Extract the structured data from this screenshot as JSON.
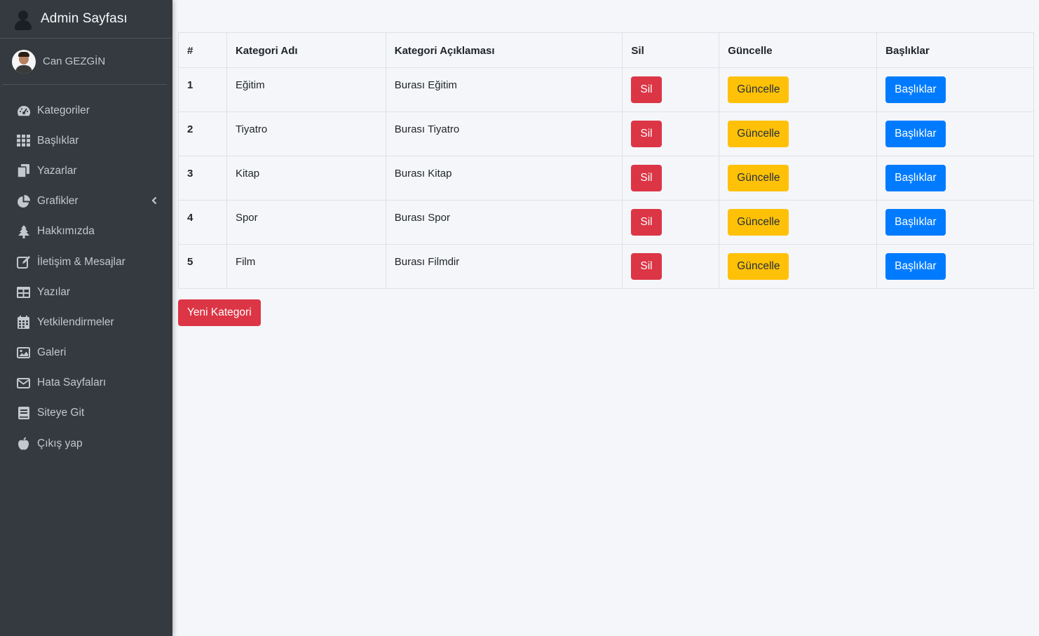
{
  "app": {
    "title": "Admin Sayfası",
    "brand_icon": "user-icon"
  },
  "user": {
    "name": "Can GEZGİN",
    "avatar_icon": "avatar"
  },
  "sidebar": {
    "items": [
      {
        "label": "Kategoriler",
        "icon": "tachometer-icon"
      },
      {
        "label": "Başlıklar",
        "icon": "grid-icon"
      },
      {
        "label": "Yazarlar",
        "icon": "copy-icon"
      },
      {
        "label": "Grafikler",
        "icon": "pie-chart-icon",
        "has_submenu": true
      },
      {
        "label": "Hakkımızda",
        "icon": "tree-icon"
      },
      {
        "label": "İletişim & Mesajlar",
        "icon": "edit-icon"
      },
      {
        "label": "Yazılar",
        "icon": "table-icon"
      },
      {
        "label": "Yetkilendirmeler",
        "icon": "calendar-icon"
      },
      {
        "label": "Galeri",
        "icon": "image-icon"
      },
      {
        "label": "Hata Sayfaları",
        "icon": "envelope-icon"
      },
      {
        "label": "Siteye Git",
        "icon": "book-icon"
      },
      {
        "label": "Çıkış yap",
        "icon": "apple-icon"
      }
    ]
  },
  "table": {
    "headers": [
      "#",
      "Kategori Adı",
      "Kategori Açıklaması",
      "Sil",
      "Güncelle",
      "Başlıklar"
    ],
    "rows": [
      {
        "id": "1",
        "name": "Eğitim",
        "description": "Burası Eğitim",
        "delete": "Sil",
        "update": "Güncelle",
        "titles": "Başlıklar"
      },
      {
        "id": "2",
        "name": "Tiyatro",
        "description": "Burası Tiyatro",
        "delete": "Sil",
        "update": "Güncelle",
        "titles": "Başlıklar"
      },
      {
        "id": "3",
        "name": "Kitap",
        "description": "Burası Kitap",
        "delete": "Sil",
        "update": "Güncelle",
        "titles": "Başlıklar"
      },
      {
        "id": "4",
        "name": "Spor",
        "description": "Burası Spor",
        "delete": "Sil",
        "update": "Güncelle",
        "titles": "Başlıklar"
      },
      {
        "id": "5",
        "name": "Film",
        "description": "Burası Filmdir",
        "delete": "Sil",
        "update": "Güncelle",
        "titles": "Başlıklar"
      }
    ]
  },
  "actions": {
    "new_category": "Yeni Kategori"
  },
  "colors": {
    "sidebar_bg": "#343a40",
    "danger": "#dc3545",
    "warning": "#ffc107",
    "primary": "#007bff",
    "page_bg": "#f4f6f9"
  }
}
